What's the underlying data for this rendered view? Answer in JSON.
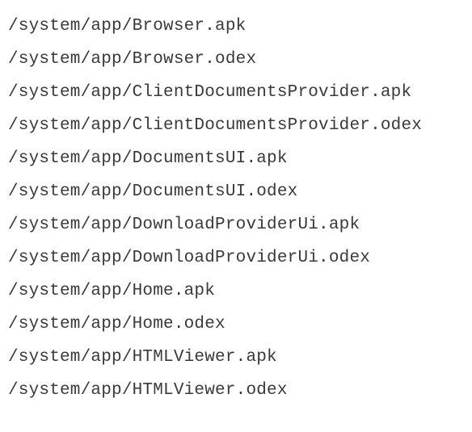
{
  "files": [
    "/system/app/Browser.apk",
    "/system/app/Browser.odex",
    "/system/app/ClientDocumentsProvider.apk",
    "/system/app/ClientDocumentsProvider.odex",
    "/system/app/DocumentsUI.apk",
    "/system/app/DocumentsUI.odex",
    "/system/app/DownloadProviderUi.apk",
    "/system/app/DownloadProviderUi.odex",
    "/system/app/Home.apk",
    "/system/app/Home.odex",
    "/system/app/HTMLViewer.apk",
    "/system/app/HTMLViewer.odex"
  ]
}
